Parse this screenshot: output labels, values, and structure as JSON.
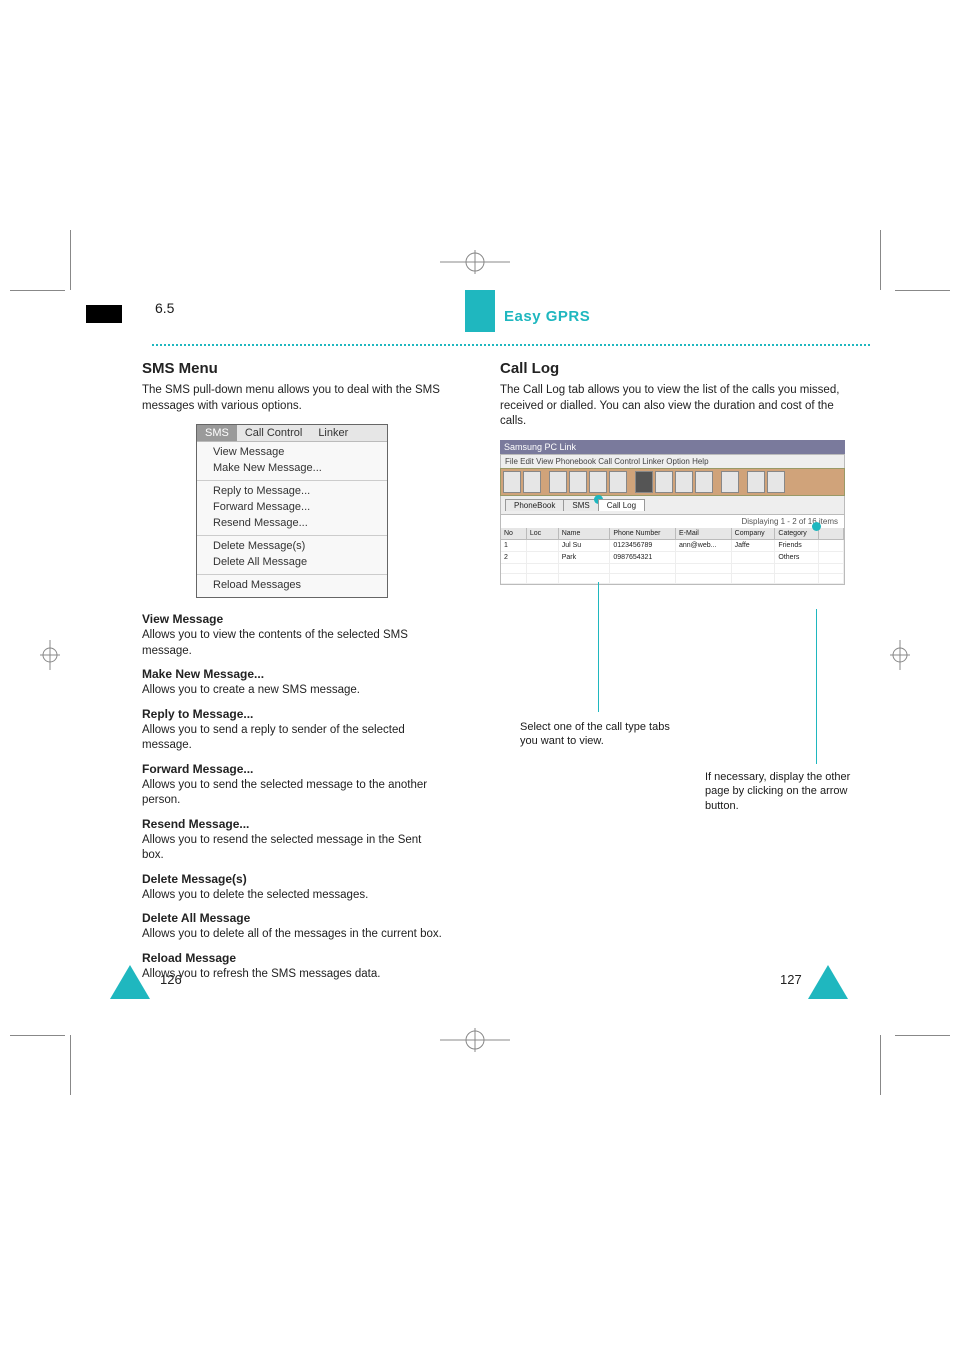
{
  "page": {
    "section_num": "6.5",
    "doc_title": "Easy GPRS",
    "left": {
      "heading": "SMS Menu",
      "intro": "The SMS pull-down menu allows you to deal with the SMS messages with various options.",
      "menu": {
        "tabs": {
          "sms": "SMS",
          "call": "Call Control",
          "linker": "Linker"
        },
        "groups": [
          [
            "View Message",
            "Make New Message..."
          ],
          [
            "Reply to Message...",
            "Forward Message...",
            "Resend Message..."
          ],
          [
            "Delete Message(s)",
            "Delete All Message"
          ],
          [
            "Reload Messages"
          ]
        ]
      },
      "options": [
        {
          "title": "View Message",
          "body": "Allows you to view the contents of the selected SMS message."
        },
        {
          "title": "Make New Message...",
          "body": "Allows you to create a new SMS message."
        },
        {
          "title": "Reply to Message...",
          "body": "Allows you to send a reply to sender of the selected message."
        },
        {
          "title": "Forward Message...",
          "body": "Allows you to send the selected message to the another person."
        },
        {
          "title": "Resend Message...",
          "body": "Allows you to resend the selected message in the Sent box."
        },
        {
          "title": "Delete Message(s)",
          "body": "Allows you to delete the selected messages."
        },
        {
          "title": "Delete All Message",
          "body": "Allows you to delete all of the messages in the current box."
        },
        {
          "title": "Reload Message",
          "body": "Allows you to refresh the SMS messages data."
        }
      ]
    },
    "right": {
      "heading": "Call Log",
      "intro": "The Call Log tab allows you to view the list of the calls you missed, received or dialled. You can also view the duration and cost of the calls.",
      "app": {
        "title": "Samsung PC Link",
        "menus": "File  Edit  View  Phonebook  Call Control  Linker  Option  Help",
        "tabs": {
          "phonebook": "PhoneBook",
          "sms": "SMS",
          "calllog": "Call Log"
        },
        "display_label": "Displaying 1 - 2 of 16 items",
        "columns": {
          "no": "No",
          "loc": "Loc",
          "name": "Name",
          "phone": "Phone Number",
          "email": "E-Mail",
          "company": "Company",
          "category": "Category",
          "last": ""
        },
        "rows": [
          {
            "no": "1",
            "loc": "",
            "name": "Jul Su",
            "phone": "0123456789",
            "email": "ann@web...",
            "company": "Jaffe",
            "category": "Friends"
          },
          {
            "no": "2",
            "loc": "",
            "name": "Park",
            "phone": "0987654321",
            "email": "",
            "company": "",
            "category": "Others"
          }
        ]
      },
      "callouts": {
        "a": "Select one of the call type tabs you want to view.",
        "b": "If necessary, display the other page by clicking on the arrow button."
      }
    },
    "pgnum_left": "126",
    "pgnum_right": "127"
  }
}
